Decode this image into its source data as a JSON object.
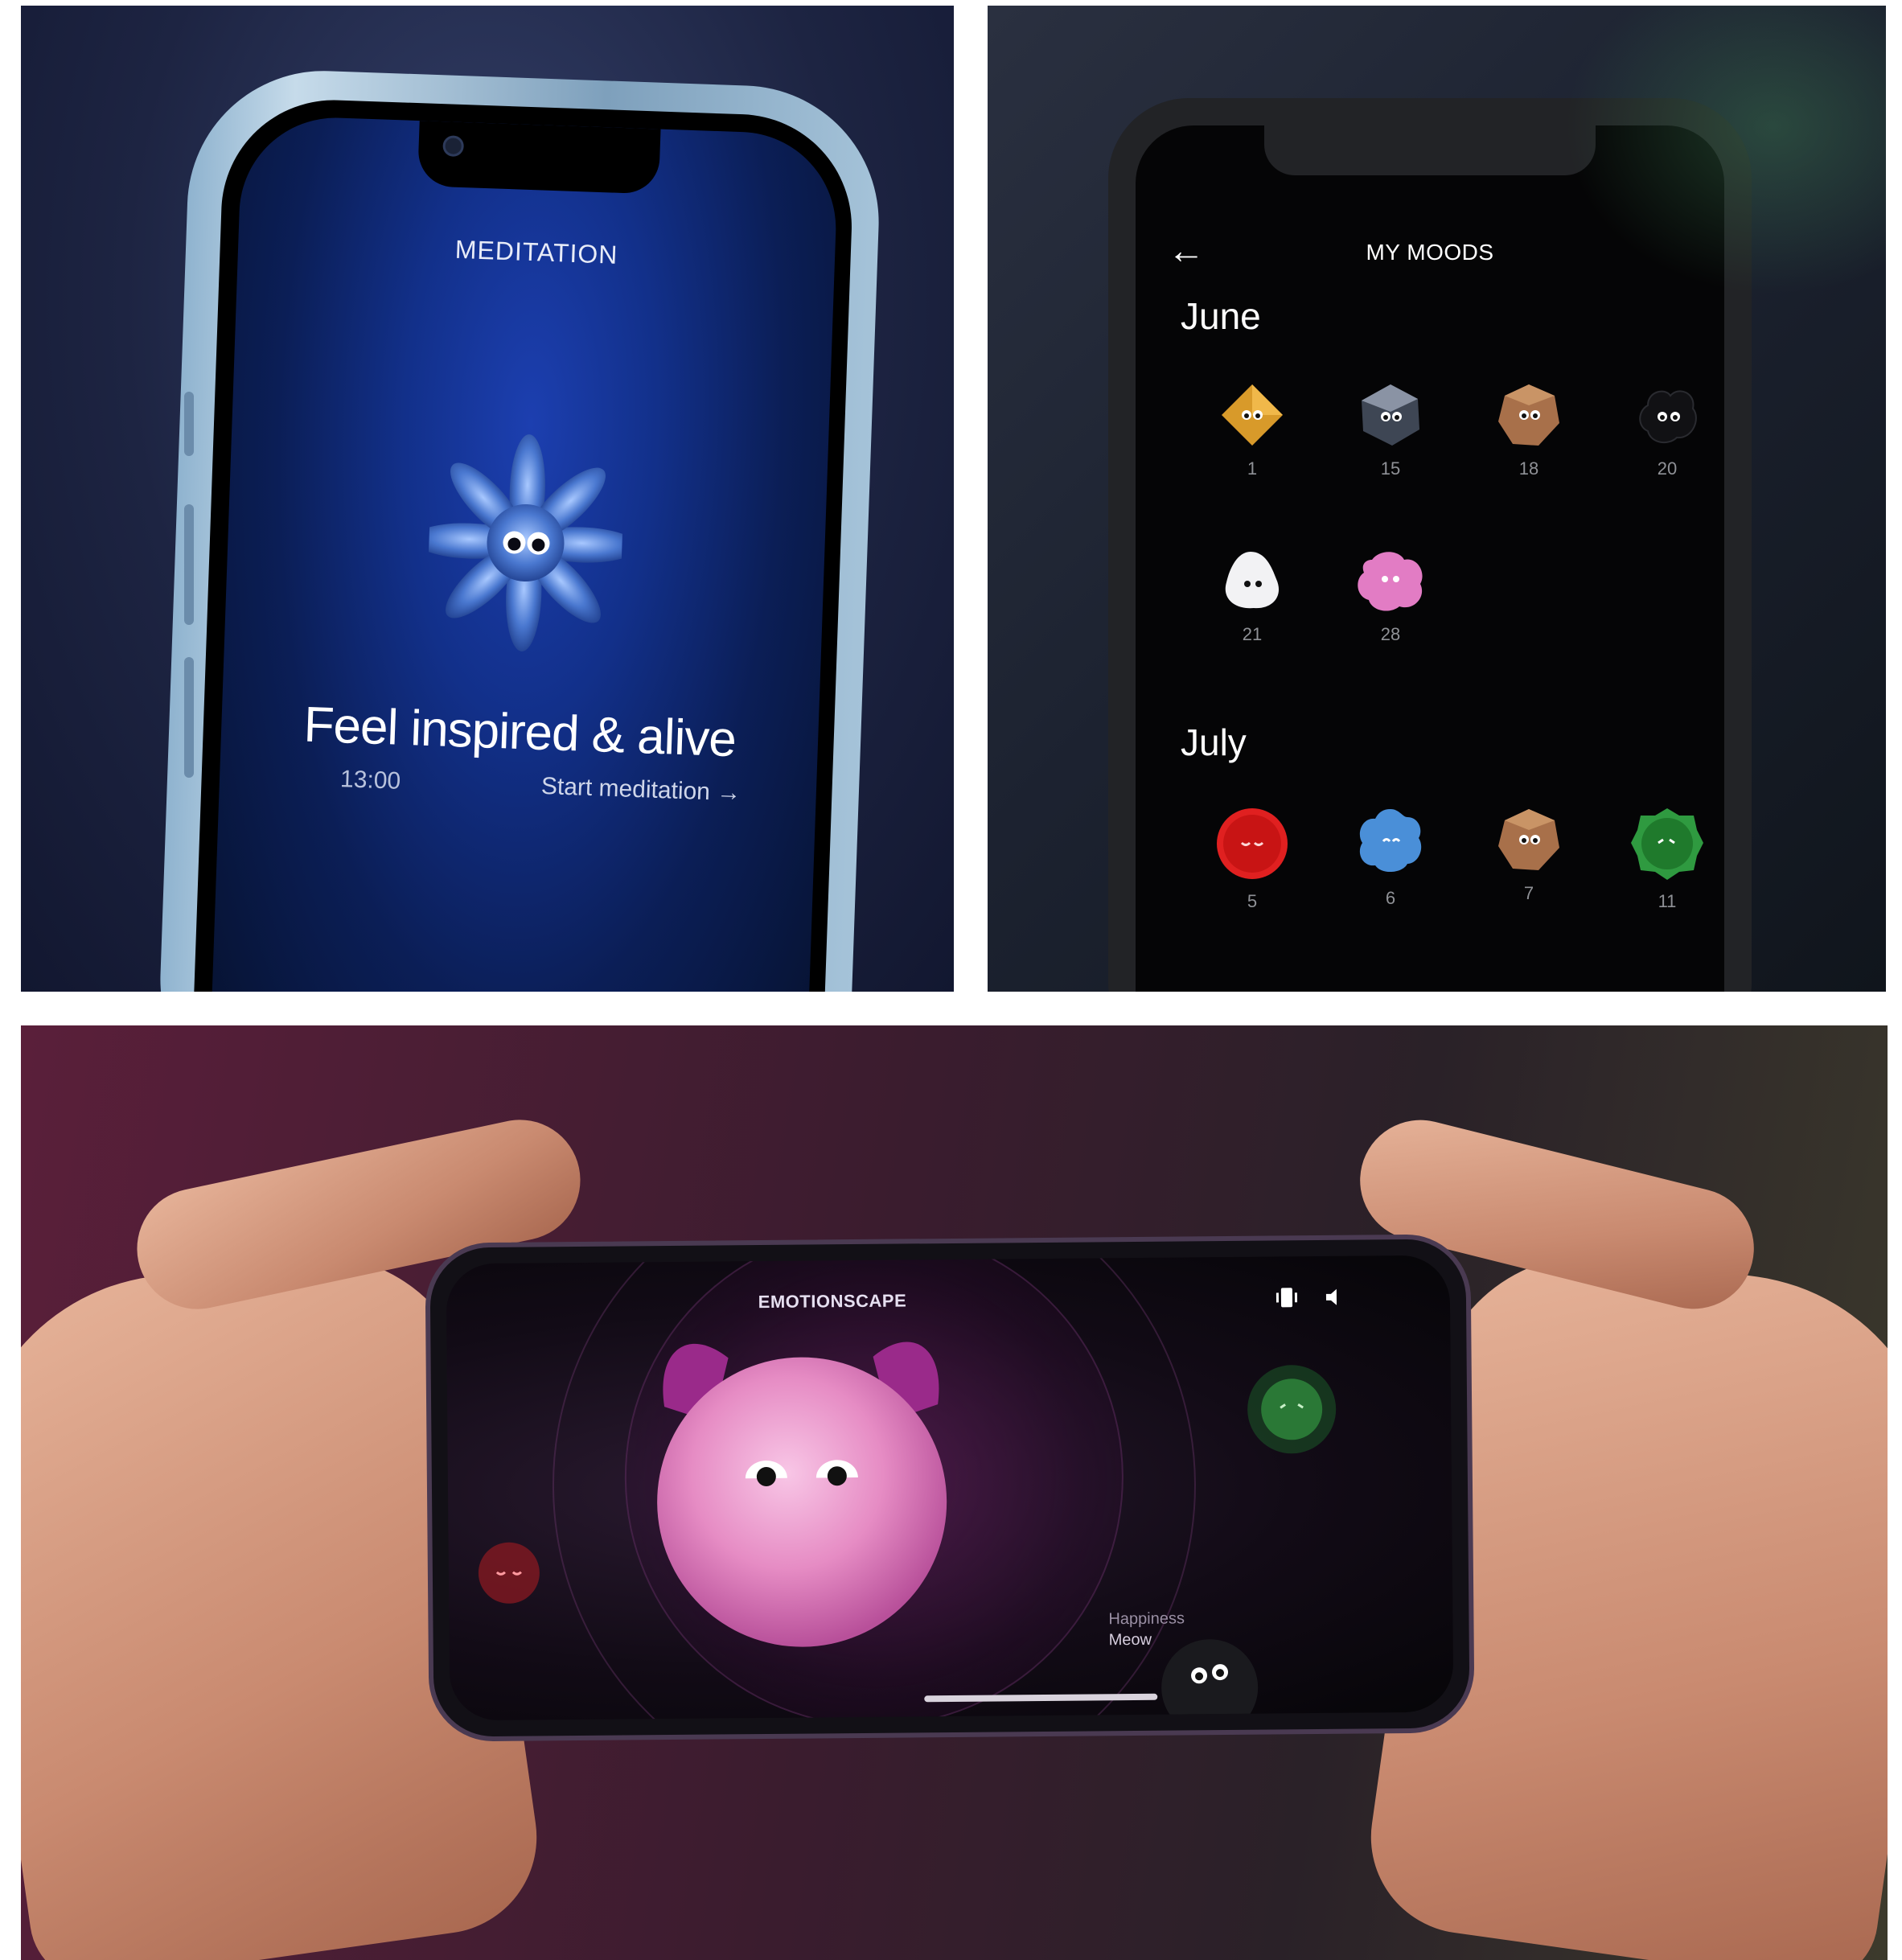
{
  "meditation": {
    "title": "MEDITATION",
    "headline": "Feel inspired & alive",
    "time": "13:00",
    "start_label": "Start meditation →",
    "creature_icon": "blue-octopus-mood-creature"
  },
  "moods": {
    "title": "MY MOODS",
    "back_icon": "arrow-left-icon",
    "months": [
      {
        "name": "June",
        "days": [
          {
            "day": "1",
            "color": "#d89a2a"
          },
          {
            "day": "15",
            "color": "#3e4654"
          },
          {
            "day": "18",
            "color": "#a8704a"
          },
          {
            "day": "20",
            "color": "#111114"
          },
          {
            "day": "21",
            "color": "#f2f2f4"
          },
          {
            "day": "28",
            "color": "#e27cc4"
          }
        ]
      },
      {
        "name": "July",
        "days": [
          {
            "day": "5",
            "color": "#e02020"
          },
          {
            "day": "6",
            "color": "#4a8fd8"
          },
          {
            "day": "7",
            "color": "#a8704a"
          },
          {
            "day": "11",
            "color": "#2f9a40"
          }
        ]
      }
    ]
  },
  "emotionscape": {
    "title": "EMOTIONSCAPE",
    "emotion_label": "Happiness",
    "creature_name": "Meow",
    "main_color": "#e68cc4",
    "icons": [
      "vibrate-icon",
      "sound-icon"
    ]
  }
}
